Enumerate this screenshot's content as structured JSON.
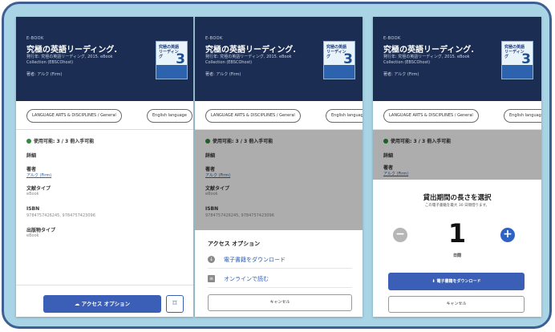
{
  "book": {
    "type_label": "E-BOOK",
    "title": "究極の英語リーディング.",
    "publisher": "発行年: 究極の英語リーディング, 2015. eBook Collection (EBSCOhost)",
    "author": "著者: アルク (Firm)",
    "cover_title": "究極の英語リーディング",
    "cover_number": "3",
    "chips": [
      "LANGUAGE ARTS & DISCIPLINES / General",
      "English language"
    ]
  },
  "availability": "使用可能: 3 / 3 冊入手可能",
  "details": {
    "heading": "詳細",
    "author_heading": "著者",
    "author_value": "アルク (Firm)",
    "doc_type_heading": "文献タイプ",
    "doc_type_value": "eBook",
    "isbn_heading": "ISBN",
    "isbn_value": "9784757426245, 9784757423096",
    "pub_type_heading": "出版物タイプ",
    "pub_type_value": "eBook"
  },
  "actions": {
    "access_button": "アクセス オプション",
    "bookmark_icon": "bookmark-icon"
  },
  "access_sheet": {
    "title": "アクセス オプション",
    "download": "電子書籍をダウンロード",
    "read_online": "オンラインで読む",
    "cancel": "キャンセル"
  },
  "checkout": {
    "title": "貸出期間の長さを選択",
    "subtitle": "この電子書籍を最大 30 日間借ります。",
    "days_value": "1",
    "days_unit": "日間",
    "download_button": "電子書籍をダウンロード",
    "cancel": "キャンセル"
  },
  "colors": {
    "header": "#1b2d52",
    "accent": "#3b5fb6",
    "available": "#2e8b3a",
    "frame_border": "#3e5f92",
    "frame_bg": "#a9d4e6"
  }
}
